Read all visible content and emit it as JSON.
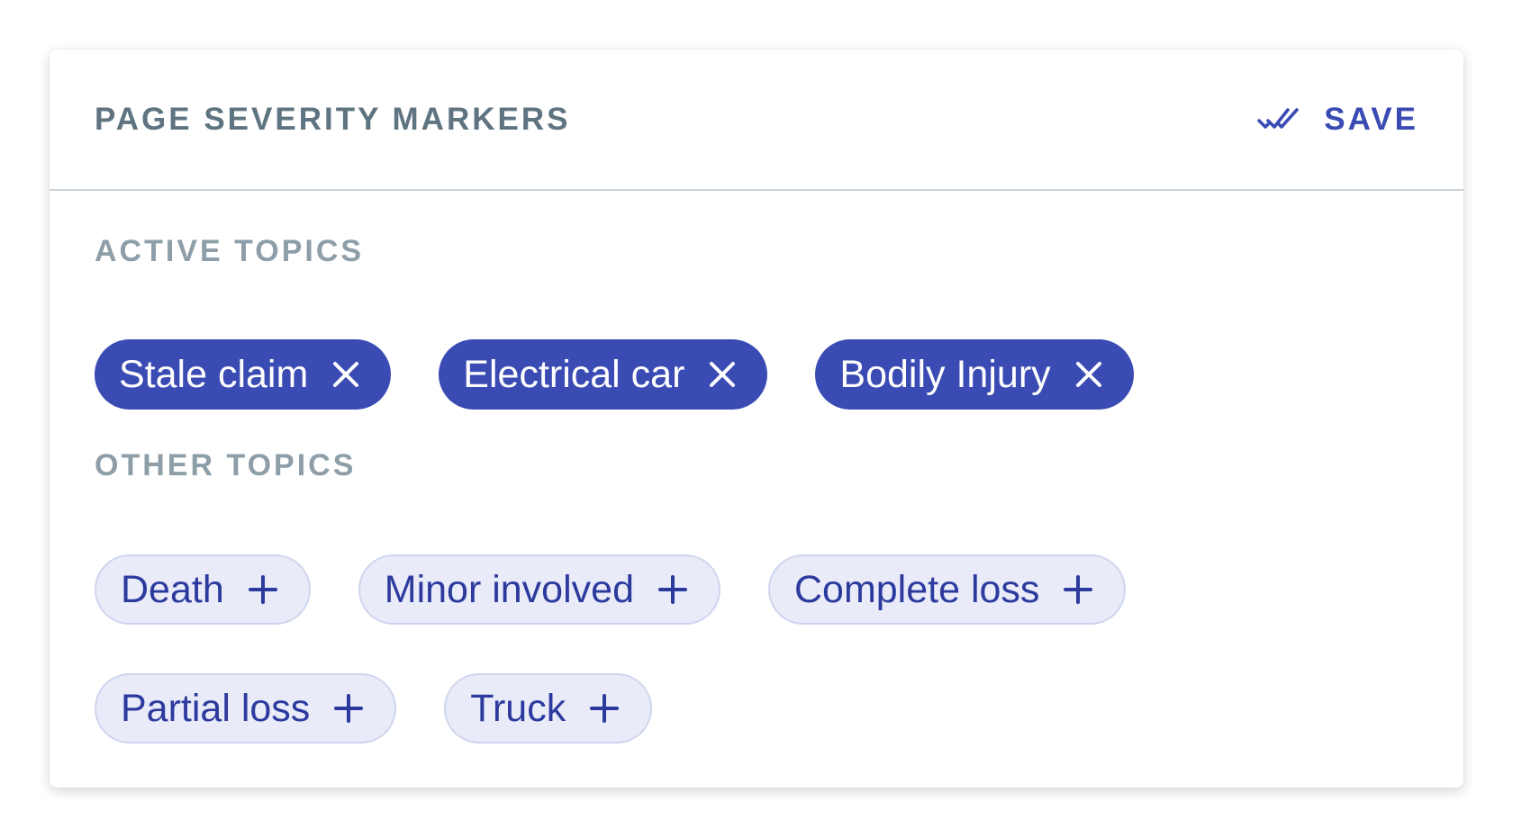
{
  "header": {
    "title": "PAGE SEVERITY MARKERS",
    "save_label": "SAVE",
    "save_icon": "double-check-icon"
  },
  "active_topics": {
    "label": "ACTIVE TOPICS",
    "items": [
      {
        "label": "Stale claim",
        "icon": "close-icon"
      },
      {
        "label": "Electrical car",
        "icon": "close-icon"
      },
      {
        "label": "Bodily Injury",
        "icon": "close-icon"
      }
    ]
  },
  "other_topics": {
    "label": "OTHER TOPICS",
    "items": [
      {
        "label": "Death",
        "icon": "plus-icon"
      },
      {
        "label": "Minor involved",
        "icon": "plus-icon"
      },
      {
        "label": "Complete loss",
        "icon": "plus-icon"
      },
      {
        "label": "Partial loss",
        "icon": "plus-icon"
      },
      {
        "label": "Truck",
        "icon": "plus-icon"
      }
    ]
  },
  "colors": {
    "accent": "#3a4bb3",
    "chip_other_bg": "#e9ebf8",
    "title_text": "#5f7481",
    "section_label_text": "#8d9ea8"
  }
}
